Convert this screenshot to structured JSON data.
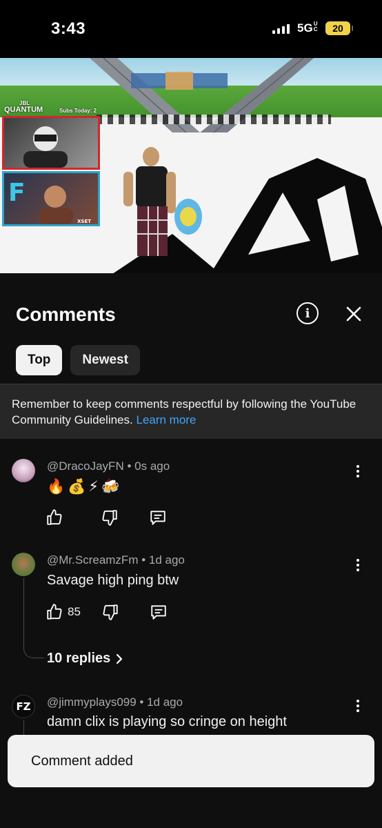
{
  "status_bar": {
    "time": "3:43",
    "network": "5G",
    "network_suffix": "UC",
    "battery": "20"
  },
  "video": {
    "brand_top": "JBL",
    "brand_name": "QUANTUM",
    "subs_label": "Subs Today: 2",
    "sponsor": "XSET"
  },
  "comments_panel": {
    "title": "Comments",
    "info_icon": "info-icon",
    "close_icon": "close-icon",
    "sort_chips": [
      {
        "label": "Top",
        "selected": true
      },
      {
        "label": "Newest",
        "selected": false
      }
    ],
    "notice": {
      "text": "Remember to keep comments respectful by following the YouTube Community Guidelines.",
      "link": "Learn more"
    }
  },
  "comments": [
    {
      "author": "@DracoJayFN",
      "time": "0s ago",
      "text": "🔥💰⚡🍻",
      "likes": ""
    },
    {
      "author": "@Mr.ScreamzFm",
      "time": "1d ago",
      "text": "Savage high ping btw",
      "likes": "85",
      "replies": "10 replies"
    },
    {
      "author": "@jimmyplays099",
      "time": "1d ago",
      "text": "damn clix is playing so cringe on height",
      "avatar_text": "FZ"
    }
  ],
  "separator": " • ",
  "toast": {
    "text": "Comment added"
  },
  "colors": {
    "background": "#0f0f0f",
    "link": "#3ea6ff",
    "battery": "#f2d249"
  }
}
